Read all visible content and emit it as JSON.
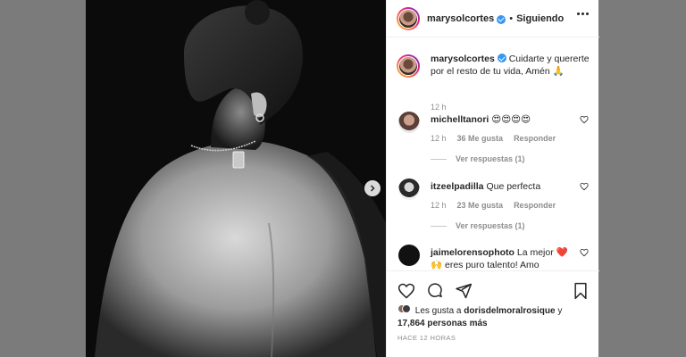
{
  "post": {
    "username": "marysolcortes",
    "follow_state": "Siguiendo",
    "separator": "•"
  },
  "caption": {
    "username": "marysolcortes",
    "text": "Cuidarte y quererte por el resto de tu vida, Amén 🙏",
    "time": "12 h"
  },
  "comments": [
    {
      "username": "michelltanori",
      "text": "😍😍😍😍",
      "time": "12 h",
      "likes": "36 Me gusta",
      "reply_label": "Responder",
      "view_replies": "Ver respuestas (1)"
    },
    {
      "username": "itzeelpadilla",
      "text": "Que perfecta",
      "time": "12 h",
      "likes": "23 Me gusta",
      "reply_label": "Responder",
      "view_replies": "Ver respuestas (1)"
    },
    {
      "username": "jaimelorensophoto",
      "text": "La mejor ❤️ 🙌 eres puro talento! Amo"
    }
  ],
  "likes": {
    "prefix": "Les gusta a",
    "first_user": "dorisdelmoralrosique",
    "connector": "y",
    "count": "17,864 personas más"
  },
  "timestamp": "HACE 12 HORAS",
  "icons": {
    "like": "heart-icon",
    "comment": "comment-icon",
    "share": "share-icon",
    "save": "bookmark-icon",
    "more": "more-icon",
    "next": "chevron-right-icon",
    "verified": "verified-icon"
  },
  "colors": {
    "verified": "#3897f0",
    "text_primary": "#262626",
    "text_secondary": "#8e8e8e",
    "border": "#efefef"
  }
}
